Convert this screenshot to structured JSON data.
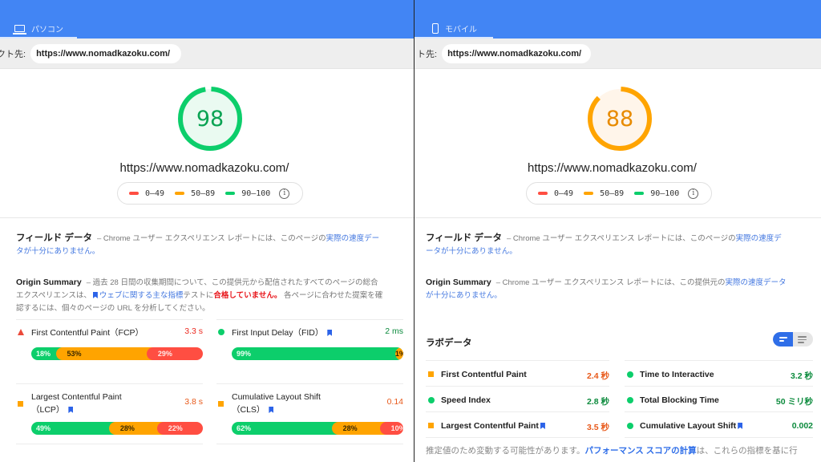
{
  "colors": {
    "header": "#4285f4",
    "pass": "#0cce6b",
    "average": "#ffa400",
    "fail": "#ff4e42",
    "pass_text": "#0b8a3c",
    "average_text": "#e8591a",
    "fail_text": "#eb2a20",
    "link": "#4478e0"
  },
  "legend": {
    "ranges": [
      {
        "label": "0–49",
        "color": "#ff4e42"
      },
      {
        "label": "50–89",
        "color": "#ffa400"
      },
      {
        "label": "90–100",
        "color": "#0cce6b"
      }
    ]
  },
  "desktop": {
    "tab_label": "パソコン",
    "tab_icon": "laptop-icon",
    "url_label": "クト先:",
    "url_value": "https://www.nomadkazoku.com/",
    "score": 98,
    "score_fraction": 0.98,
    "score_color": "#0cce6b",
    "score_bg": "#eafaf1",
    "score_text_color": "#0aa353",
    "page_url": "https://www.nomadkazoku.com/",
    "field_data": {
      "title": "フィールド データ",
      "text": "– Chrome ユーザー エクスペリエンス レポートには、このページの",
      "link": "実際の速度データが十分にありません。"
    },
    "origin_summary": {
      "title": "Origin Summary",
      "text1": "– 過去 28 日間の収集期間について、この提供元から配信されたすべてのページの総合エクスペリエンスは、",
      "link": "ウェブに関する主な指標",
      "text2": "テストに",
      "fail": "合格していません。",
      "text3": " 各ページに合わせた提案を確認するには、個々のページの URL を分析してください。"
    },
    "metrics": [
      {
        "name": "First Contentful Paint（FCP）",
        "value": "3.3 s",
        "status": "fail",
        "icon": "triangle-icon",
        "bookmark": false,
        "dist": [
          18,
          53,
          29
        ]
      },
      {
        "name": "First Input Delay（FID）",
        "value": "2 ms",
        "status": "pass",
        "icon": "circle-icon",
        "bookmark": true,
        "dist": [
          99,
          1,
          0
        ]
      },
      {
        "name": "Largest Contentful Paint",
        "name2": "（LCP）",
        "value": "3.8 s",
        "status": "average",
        "icon": "square-icon",
        "bookmark": true,
        "dist": [
          49,
          28,
          22
        ]
      },
      {
        "name": "Cumulative Layout Shift",
        "name2": "（CLS）",
        "value": "0.14",
        "status": "average",
        "icon": "square-icon",
        "bookmark": true,
        "dist": [
          62,
          28,
          10
        ]
      }
    ]
  },
  "mobile": {
    "tab_label": "モバイル",
    "tab_icon": "phone-icon",
    "url_label": "ト先:",
    "url_value": "https://www.nomadkazoku.com/",
    "score": 88,
    "score_fraction": 0.88,
    "score_color": "#ffa400",
    "score_bg": "#fff5ea",
    "score_text_color": "#e88b00",
    "page_url": "https://www.nomadkazoku.com/",
    "field_data": {
      "title": "フィールド データ",
      "text": "– Chrome ユーザー エクスペリエンス レポートには、このページの",
      "link": "実際の速度データが十分にありません。"
    },
    "origin_summary": {
      "title": "Origin Summary",
      "text": "– Chrome ユーザー エクスペリエンス レポートには、この提供元の",
      "link": "実際の速度データが十分にありません。"
    },
    "lab": {
      "title": "ラボデータ",
      "toggle_states": [
        "compact-view",
        "list-view"
      ],
      "metrics": [
        {
          "name": "First Contentful Paint",
          "value": "2.4 秒",
          "status": "average",
          "icon": "square-icon",
          "bookmark": false
        },
        {
          "name": "Time to Interactive",
          "value": "3.2 秒",
          "status": "pass",
          "icon": "circle-icon",
          "bookmark": false
        },
        {
          "name": "Speed Index",
          "value": "2.8 秒",
          "status": "pass",
          "icon": "circle-icon",
          "bookmark": false
        },
        {
          "name": "Total Blocking Time",
          "value": "50 ミリ秒",
          "status": "pass",
          "icon": "circle-icon",
          "bookmark": false
        },
        {
          "name": "Largest Contentful Paint",
          "value": "3.5 秒",
          "status": "average",
          "icon": "square-icon",
          "bookmark": true
        },
        {
          "name": "Cumulative Layout Shift",
          "value": "0.002",
          "status": "pass",
          "icon": "circle-icon",
          "bookmark": true
        }
      ],
      "note_text": "推定値のため変動する可能性があります。",
      "note_link": "パフォーマンス スコアの計算",
      "note_text2": "は、これらの指標を基に行"
    }
  }
}
